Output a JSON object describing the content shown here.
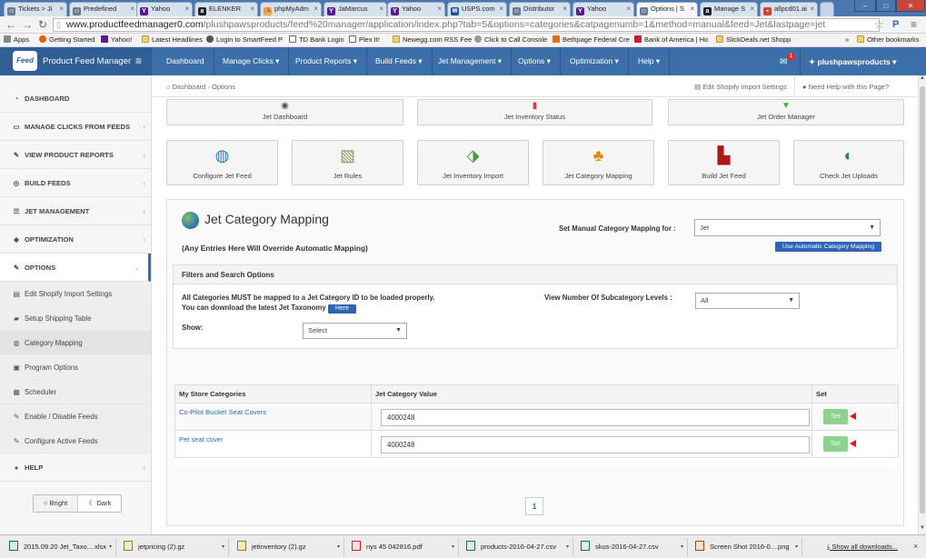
{
  "browser": {
    "tabs": [
      {
        "label": "Tickets > Ji",
        "icon": "support-icon",
        "active": false
      },
      {
        "label": "Predefined",
        "icon": "support-icon",
        "active": false
      },
      {
        "label": "Yahoo",
        "icon": "yahoo-icon",
        "active": false
      },
      {
        "label": "ELENKER",
        "icon": "amazon-icon",
        "active": false
      },
      {
        "label": "phpMyAdm",
        "icon": "phpmyadmin-icon",
        "active": false
      },
      {
        "label": "JaMarcus",
        "icon": "yahoo-icon",
        "active": false
      },
      {
        "label": "Yahoo",
        "icon": "yahoo-icon",
        "active": false
      },
      {
        "label": "USPS.com",
        "icon": "usps-icon",
        "active": false
      },
      {
        "label": "Distributor",
        "icon": "support-icon",
        "active": false
      },
      {
        "label": "Yahoo",
        "icon": "yahoo-icon",
        "active": false
      },
      {
        "label": "Options | S",
        "icon": "support-icon",
        "active": true
      },
      {
        "label": "Manage S",
        "icon": "amazon-icon",
        "active": false
      },
      {
        "label": "allpcd01.ai",
        "icon": "page-icon",
        "active": false
      }
    ],
    "url_host": "www.productfeedmanager0.com",
    "url_path": "/plushpawsproducts/feed%20manager/application/index.php?tab=5&options=categories&catpagenumb=1&method=manual&feed=Jet&lastpage=jet",
    "bookmarks": [
      "Apps",
      "Getting Started",
      "Yahoo!",
      "Latest Headlines",
      "Login to SmartFeed P",
      "TD Bank Login",
      "Plex It!",
      "Newegg.com RSS Fee",
      "Click to Call Console",
      "Bethpage Federal Cre",
      "Bank of America | Ho",
      "SlickDeals.net Shopp"
    ],
    "bookmarks_more": "»",
    "other_bookmarks": "Other bookmarks"
  },
  "app": {
    "logo_text": "Feed",
    "title": "Product Feed Manager",
    "menu_icon": "hamburger-icon",
    "nav": [
      {
        "label": "Dashboard",
        "caret": false
      },
      {
        "label": "Manage Clicks",
        "caret": true
      },
      {
        "label": "Product Reports",
        "caret": true
      },
      {
        "label": "Build Feeds",
        "caret": true
      },
      {
        "label": "Jet Management",
        "caret": true
      },
      {
        "label": "Options",
        "caret": true
      },
      {
        "label": "Optimization",
        "caret": true
      },
      {
        "label": "Help",
        "caret": true
      }
    ],
    "notification_count": "1",
    "user": "plushpawsproducts"
  },
  "sidebar": {
    "items": [
      {
        "label": "DASHBOARD",
        "icon": "dashboard-icon",
        "chevron": ""
      },
      {
        "label": "MANAGE CLICKS FROM FEEDS",
        "icon": "monitor-icon",
        "chevron": "‹"
      },
      {
        "label": "VIEW PRODUCT REPORTS",
        "icon": "edit-icon",
        "chevron": "‹"
      },
      {
        "label": "BUILD FEEDS",
        "icon": "target-icon",
        "chevron": "‹"
      },
      {
        "label": "JET MANAGEMENT",
        "icon": "list-icon",
        "chevron": "‹"
      },
      {
        "label": "OPTIMIZATION",
        "icon": "tag-icon",
        "chevron": "‹"
      },
      {
        "label": "OPTIONS",
        "icon": "wrench-icon",
        "chevron": "⌄"
      }
    ],
    "subitems": [
      {
        "label": "Edit Shopify Import Settings",
        "icon": "shopping-icon"
      },
      {
        "label": "Setup Shipping Table",
        "icon": "truck-icon"
      },
      {
        "label": "Category Mapping",
        "icon": "globe-icon"
      },
      {
        "label": "Program Options",
        "icon": "briefcase-icon"
      },
      {
        "label": "Scheduler",
        "icon": "calendar-icon"
      },
      {
        "label": "Enable / Disable Feeds",
        "icon": "edit-icon"
      },
      {
        "label": "Configure Active Feeds",
        "icon": "wrench-icon"
      }
    ],
    "help": {
      "label": "HELP",
      "icon": "info-icon",
      "chevron": "‹"
    },
    "theme_bright": "Bright",
    "theme_dark": "Dark"
  },
  "content": {
    "breadcrumb": [
      "Dashboard",
      "Options"
    ],
    "header_links": [
      "Edit Shopify Import Settings",
      "Need Help with this Page?"
    ],
    "top_buttons": [
      "Jet Dashboard",
      "Jet Inventory Status",
      "Jet Order Manager"
    ],
    "tile_buttons": [
      {
        "label": "Configure Jet Feed",
        "icon": "magnifier-globe-icon"
      },
      {
        "label": "Jet Rules",
        "icon": "clipboard-icon"
      },
      {
        "label": "Jet Inventory Import",
        "icon": "import-icon"
      },
      {
        "label": "Jet Category Mapping",
        "icon": "hierarchy-icon"
      },
      {
        "label": "Build Jet Feed",
        "icon": "bricks-icon"
      },
      {
        "label": "Check Jet Uploads",
        "icon": "upload-globe-icon"
      }
    ],
    "mapping": {
      "title": "Jet Category Mapping",
      "subtitle": "(Any Entries Here Will Override Automatic Mapping)",
      "manual_label": "Set Manual Category Mapping for :",
      "manual_value": "Jet",
      "auto_button": "Use Automatic Category Mapping"
    },
    "filters": {
      "title": "Filters and Search Options",
      "note_line1": "All Categories MUST be mapped to a Jet Category ID to be loaded properly.",
      "note_line2": "You can download the latest Jet Taxonomy",
      "here_button": "Here",
      "levels_label": "View Number Of Subcategory Levels :",
      "levels_value": "All",
      "show_label": "Show:",
      "show_value": "Select"
    },
    "table": {
      "headers": [
        "My Store Categories",
        "Jet Category Value",
        "Set"
      ],
      "rows": [
        {
          "category": "Co-Pilot Bucket Seat Covers",
          "value": "4000248",
          "set": "Set"
        },
        {
          "category": "Pet seat cover",
          "value": "4000248",
          "set": "Set"
        }
      ]
    },
    "page": "1"
  },
  "downloads": {
    "items": [
      {
        "name": "2015.09.20 Jet_Taxo....xlsx",
        "icon": "excel-icon"
      },
      {
        "name": "jetpricing (2).gz",
        "icon": "archive-icon"
      },
      {
        "name": "jetinventory (2).gz",
        "icon": "archive-icon"
      },
      {
        "name": "nys 45 042816.pdf",
        "icon": "pdf-icon"
      },
      {
        "name": "products-2016-04-27.csv",
        "icon": "csv-icon"
      },
      {
        "name": "skus-2016-04-27.csv",
        "icon": "csv-icon"
      },
      {
        "name": "Screen Shot 2016-0....png",
        "icon": "image-icon"
      }
    ],
    "show_all": "Show all downloads..."
  },
  "colors": {
    "header_blue": "#3c6fa7",
    "brand_blue": "#2f5f94",
    "button_blue": "#2f63b6",
    "set_green": "#8fd18f",
    "link_blue": "#2a6ab3"
  }
}
